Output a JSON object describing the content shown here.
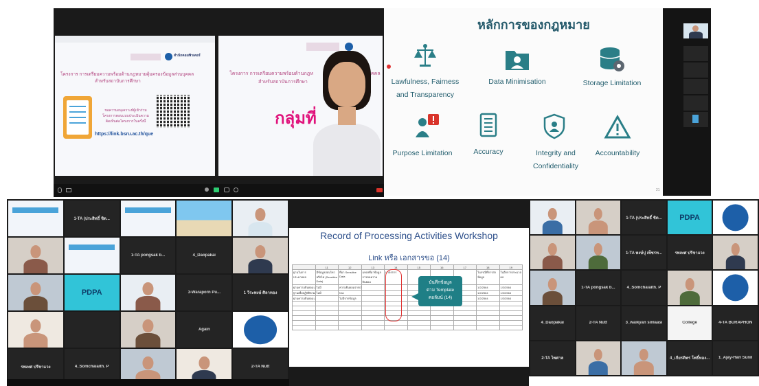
{
  "panel_a": {
    "left_slide": {
      "logo_text": "สำนักคอมพิวเตอร์",
      "title_line1": "โครงการ การเตรียมความพร้อมด้านกฎหมายคุ้มครองข้อมูลส่วนบุคคล",
      "title_line2": "สำหรับสถาบันการศึกษา",
      "eval_line1": "ขอความอนุเคราะห์ผู้เข้าร่วม",
      "eval_line2": "โครงการตอบแบบประเมินความ",
      "eval_line3": "คิดเห็นต่อโครงการในครั้งนี้",
      "link": "https://link.bsru.ac.th/que"
    },
    "right_slide": {
      "title_part": "โครงการ การเตรียมความพร้อมด้านกฎห",
      "title_end": "คคล",
      "title_line2": "สำหรับสถาบันการศึกษา",
      "group_text": "กลุ่มที่"
    }
  },
  "panel_b": {
    "title": "หลักการของกฎหมาย",
    "principles": [
      {
        "label": "Lawfulness, Fairness",
        "label2": "and Transparency",
        "icon": "scales-icon"
      },
      {
        "label": "Data Minimisation",
        "label2": "",
        "icon": "folder-user-icon"
      },
      {
        "label": "Storage Limitation",
        "label2": "",
        "icon": "database-gear-icon"
      },
      {
        "label": "Purpose Limitation",
        "label2": "",
        "icon": "person-alert-icon"
      },
      {
        "label": "Accuracy",
        "label2": "",
        "icon": "checklist-icon"
      },
      {
        "label": "Integrity and",
        "label2": "Confidentiality",
        "icon": "shield-user-icon"
      },
      {
        "label": "Accountability",
        "label2": "",
        "icon": "warning-icon"
      }
    ],
    "page_number": "21"
  },
  "panel_c": {
    "tiles": [
      {
        "name": "",
        "kind": "slide"
      },
      {
        "name": "1-TA (ประสิทธิ์ ชิด...",
        "kind": "text"
      },
      {
        "name": "",
        "kind": "slide"
      },
      {
        "name": "",
        "kind": "beach"
      },
      {
        "name": "",
        "kind": "person"
      },
      {
        "name": "",
        "kind": "person"
      },
      {
        "name": "",
        "kind": "slide"
      },
      {
        "name": "1-TA pongsak b...",
        "kind": "text"
      },
      {
        "name": "4_Daopakai",
        "kind": "text"
      },
      {
        "name": "",
        "kind": "person"
      },
      {
        "name": "",
        "kind": "person"
      },
      {
        "name": "PDPA",
        "kind": "pdpa"
      },
      {
        "name": "",
        "kind": "person"
      },
      {
        "name": "3-Waraporn Pu...",
        "kind": "text"
      },
      {
        "name": "1 วีระพงษ์ ศิลาทอง",
        "kind": "text"
      },
      {
        "name": "",
        "kind": "person"
      },
      {
        "name": "",
        "kind": "dark"
      },
      {
        "name": "",
        "kind": "child"
      },
      {
        "name": "Again",
        "kind": "text"
      },
      {
        "name": "",
        "kind": "logo"
      },
      {
        "name": "รพเทศ ปรีชาแวง",
        "kind": "text"
      },
      {
        "name": "4_Somchaiaith. P",
        "kind": "text"
      },
      {
        "name": "",
        "kind": "person"
      },
      {
        "name": "",
        "kind": "person"
      },
      {
        "name": "2-TA Nutt",
        "kind": "text"
      }
    ]
  },
  "panel_d": {
    "title": "Record of Processing Activities Workshop",
    "subtitle": "Link หรือ เอกสารขอ (14)",
    "callout_line1": "บันทึกข้อมูล",
    "callout_line2": "ตาม Template",
    "callout_line3": "คอลัมน์ (14)",
    "col_numbers": [
      "",
      "11",
      "12",
      "13",
      "14",
      "15",
      "16",
      "17",
      "18",
      "19"
    ],
    "headers": [
      "ฐานในการประมวลผล",
      "มีข้อมูลอ่อนไหวหรือไม่ (Sensitive Data)",
      "ที่มา Sensitive Data",
      "แหล่งที่มาข้อมูล การขอความยินยอม",
      "มาตรการ",
      "",
      "",
      "",
      "ในกรณีที่การส่งข้อมูล",
      "ในอีกการประมวลผล"
    ],
    "rows": [
      [
        "ฐานความยินยอม (Consent)",
        "ไม่มี",
        "ความยินยอมจากเจ้าของข้อมูล",
        "",
        "",
        "",
        "",
        "",
        "1/2/2564",
        "1/2/2564"
      ],
      [
        "ฐานเพื่อปฏิบัติตามกฎหมาย (Legal Obligation)",
        "ไม่มี",
        "N/A",
        "",
        "",
        "",
        "",
        "",
        "1/2/2564",
        "1/2/2564"
      ],
      [
        "ฐานความยินยอม (Consent)",
        "",
        "ไม่มีจากข้อมูล",
        "",
        "",
        "",
        "",
        "",
        "1/2/2564",
        "1/2/2564"
      ]
    ]
  },
  "panel_e": {
    "tiles": [
      {
        "name": "",
        "kind": "person"
      },
      {
        "name": "",
        "kind": "person"
      },
      {
        "name": "1-TA (ประสิทธิ์ ชิด...",
        "kind": "text"
      },
      {
        "name": "PDPA",
        "kind": "pdpa"
      },
      {
        "name": "",
        "kind": "logo"
      },
      {
        "name": "",
        "kind": "person"
      },
      {
        "name": "",
        "kind": "person"
      },
      {
        "name": "1-TA พงษ์ปุ เพ็ชรท...",
        "kind": "text"
      },
      {
        "name": "รพเทศ ปรีชาแวง",
        "kind": "text"
      },
      {
        "name": "",
        "kind": "person"
      },
      {
        "name": "",
        "kind": "person"
      },
      {
        "name": "1-TA pongsak b...",
        "kind": "text"
      },
      {
        "name": "4_Somchaiaith. P",
        "kind": "text"
      },
      {
        "name": "",
        "kind": "person"
      },
      {
        "name": "",
        "kind": "logo"
      },
      {
        "name": "4_Daopakai",
        "kind": "text"
      },
      {
        "name": "2-TA Nutt",
        "kind": "text"
      },
      {
        "name": "3_waikyan sinlaasi",
        "kind": "text"
      },
      {
        "name": "College",
        "kind": "college"
      },
      {
        "name": "4-TA BURAPHON",
        "kind": "text"
      },
      {
        "name": "2-TA ไพศาล",
        "kind": "text"
      },
      {
        "name": "",
        "kind": "person"
      },
      {
        "name": "",
        "kind": "person"
      },
      {
        "name": "4_เกียรติพร โพธิ์ทอง...",
        "kind": "text"
      },
      {
        "name": "1_Ajay-Hari Sunil",
        "kind": "text"
      }
    ]
  },
  "colors": {
    "zoom_dark": "#1a1a1a",
    "tile_bg": "#242424",
    "accent_teal": "#1f7f86",
    "accent_pink": "#d23f8a",
    "rec_title": "#2d4f8a"
  }
}
